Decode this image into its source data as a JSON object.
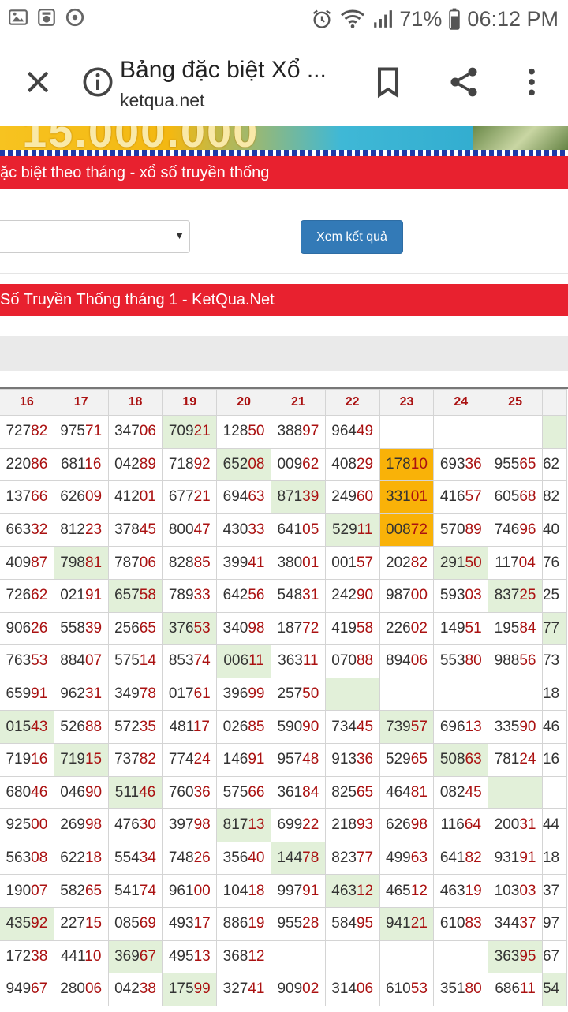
{
  "status_bar": {
    "battery": "71%",
    "time": "06:12 PM"
  },
  "toolbar": {
    "title": "Bảng đặc biệt Xổ ...",
    "url": "ketqua.net"
  },
  "banner": {
    "amount": "15.000.000"
  },
  "section1": {
    "title": "ặc biệt theo tháng - xổ số truyền thống"
  },
  "form": {
    "select_value": "",
    "submit_label": "Xem kết quả"
  },
  "section2": {
    "title": "Số Truyền Thống tháng 1 - KetQua.Net"
  },
  "table": {
    "headers": [
      "16",
      "17",
      "18",
      "19",
      "20",
      "21",
      "22",
      "23",
      "24",
      "25",
      ""
    ],
    "rows": [
      [
        {
          "v": "72782",
          "c": ""
        },
        {
          "v": "97571",
          "c": ""
        },
        {
          "v": "34706",
          "c": ""
        },
        {
          "v": "70921",
          "c": "g"
        },
        {
          "v": "12850",
          "c": ""
        },
        {
          "v": "38897",
          "c": ""
        },
        {
          "v": "96449",
          "c": ""
        },
        {
          "v": "",
          "c": ""
        },
        {
          "v": "",
          "c": ""
        },
        {
          "v": "",
          "c": ""
        },
        {
          "v": "",
          "c": "g"
        }
      ],
      [
        {
          "v": "22086",
          "c": ""
        },
        {
          "v": "68116",
          "c": ""
        },
        {
          "v": "04289",
          "c": ""
        },
        {
          "v": "71892",
          "c": ""
        },
        {
          "v": "65208",
          "c": "g"
        },
        {
          "v": "00962",
          "c": ""
        },
        {
          "v": "40829",
          "c": ""
        },
        {
          "v": "17810",
          "c": "o"
        },
        {
          "v": "69336",
          "c": ""
        },
        {
          "v": "95565",
          "c": ""
        },
        {
          "v": "62",
          "c": ""
        }
      ],
      [
        {
          "v": "13766",
          "c": ""
        },
        {
          "v": "62609",
          "c": ""
        },
        {
          "v": "41201",
          "c": ""
        },
        {
          "v": "67721",
          "c": ""
        },
        {
          "v": "69463",
          "c": ""
        },
        {
          "v": "87139",
          "c": "g"
        },
        {
          "v": "24960",
          "c": ""
        },
        {
          "v": "33101",
          "c": "o"
        },
        {
          "v": "41657",
          "c": ""
        },
        {
          "v": "60568",
          "c": ""
        },
        {
          "v": "82",
          "c": ""
        }
      ],
      [
        {
          "v": "66332",
          "c": ""
        },
        {
          "v": "81223",
          "c": ""
        },
        {
          "v": "37845",
          "c": ""
        },
        {
          "v": "80047",
          "c": ""
        },
        {
          "v": "43033",
          "c": ""
        },
        {
          "v": "64105",
          "c": ""
        },
        {
          "v": "52911",
          "c": "g"
        },
        {
          "v": "00872",
          "c": "o"
        },
        {
          "v": "57089",
          "c": ""
        },
        {
          "v": "74696",
          "c": ""
        },
        {
          "v": "40",
          "c": ""
        }
      ],
      [
        {
          "v": "40987",
          "c": ""
        },
        {
          "v": "79881",
          "c": "g"
        },
        {
          "v": "78706",
          "c": ""
        },
        {
          "v": "82885",
          "c": ""
        },
        {
          "v": "39941",
          "c": ""
        },
        {
          "v": "38001",
          "c": ""
        },
        {
          "v": "00157",
          "c": ""
        },
        {
          "v": "20282",
          "c": ""
        },
        {
          "v": "29150",
          "c": "g"
        },
        {
          "v": "11704",
          "c": ""
        },
        {
          "v": "76",
          "c": ""
        }
      ],
      [
        {
          "v": "72662",
          "c": ""
        },
        {
          "v": "02191",
          "c": ""
        },
        {
          "v": "65758",
          "c": "g"
        },
        {
          "v": "78933",
          "c": ""
        },
        {
          "v": "64256",
          "c": ""
        },
        {
          "v": "54831",
          "c": ""
        },
        {
          "v": "24290",
          "c": ""
        },
        {
          "v": "98700",
          "c": ""
        },
        {
          "v": "59303",
          "c": ""
        },
        {
          "v": "83725",
          "c": "g"
        },
        {
          "v": "25",
          "c": ""
        }
      ],
      [
        {
          "v": "90626",
          "c": ""
        },
        {
          "v": "55839",
          "c": ""
        },
        {
          "v": "25665",
          "c": ""
        },
        {
          "v": "37653",
          "c": "g"
        },
        {
          "v": "34098",
          "c": ""
        },
        {
          "v": "18772",
          "c": ""
        },
        {
          "v": "41958",
          "c": ""
        },
        {
          "v": "22602",
          "c": ""
        },
        {
          "v": "14951",
          "c": ""
        },
        {
          "v": "19584",
          "c": ""
        },
        {
          "v": "77",
          "c": "g"
        }
      ],
      [
        {
          "v": "76353",
          "c": ""
        },
        {
          "v": "88407",
          "c": ""
        },
        {
          "v": "57514",
          "c": ""
        },
        {
          "v": "85374",
          "c": ""
        },
        {
          "v": "00611",
          "c": "g"
        },
        {
          "v": "36311",
          "c": ""
        },
        {
          "v": "07088",
          "c": ""
        },
        {
          "v": "89406",
          "c": ""
        },
        {
          "v": "55380",
          "c": ""
        },
        {
          "v": "98856",
          "c": ""
        },
        {
          "v": "73",
          "c": ""
        }
      ],
      [
        {
          "v": "65991",
          "c": ""
        },
        {
          "v": "96231",
          "c": ""
        },
        {
          "v": "34978",
          "c": ""
        },
        {
          "v": "01761",
          "c": ""
        },
        {
          "v": "39699",
          "c": ""
        },
        {
          "v": "25750",
          "c": ""
        },
        {
          "v": "",
          "c": "g"
        },
        {
          "v": "",
          "c": ""
        },
        {
          "v": "",
          "c": ""
        },
        {
          "v": "",
          "c": ""
        },
        {
          "v": "18",
          "c": ""
        }
      ],
      [
        {
          "v": "01543",
          "c": "g"
        },
        {
          "v": "52688",
          "c": ""
        },
        {
          "v": "57235",
          "c": ""
        },
        {
          "v": "48117",
          "c": ""
        },
        {
          "v": "02685",
          "c": ""
        },
        {
          "v": "59090",
          "c": ""
        },
        {
          "v": "73445",
          "c": ""
        },
        {
          "v": "73957",
          "c": "g"
        },
        {
          "v": "69613",
          "c": ""
        },
        {
          "v": "33590",
          "c": ""
        },
        {
          "v": "46",
          "c": ""
        }
      ],
      [
        {
          "v": "71916",
          "c": ""
        },
        {
          "v": "71915",
          "c": "g"
        },
        {
          "v": "73782",
          "c": ""
        },
        {
          "v": "77424",
          "c": ""
        },
        {
          "v": "14691",
          "c": ""
        },
        {
          "v": "95748",
          "c": ""
        },
        {
          "v": "91336",
          "c": ""
        },
        {
          "v": "52965",
          "c": ""
        },
        {
          "v": "50863",
          "c": "g"
        },
        {
          "v": "78124",
          "c": ""
        },
        {
          "v": "16",
          "c": ""
        }
      ],
      [
        {
          "v": "68046",
          "c": ""
        },
        {
          "v": "04690",
          "c": ""
        },
        {
          "v": "51146",
          "c": "g"
        },
        {
          "v": "76036",
          "c": ""
        },
        {
          "v": "57566",
          "c": ""
        },
        {
          "v": "36184",
          "c": ""
        },
        {
          "v": "82565",
          "c": ""
        },
        {
          "v": "46481",
          "c": ""
        },
        {
          "v": "08245",
          "c": ""
        },
        {
          "v": "",
          "c": "g"
        },
        {
          "v": "",
          "c": ""
        }
      ],
      [
        {
          "v": "92500",
          "c": ""
        },
        {
          "v": "26998",
          "c": ""
        },
        {
          "v": "47630",
          "c": ""
        },
        {
          "v": "39798",
          "c": ""
        },
        {
          "v": "81713",
          "c": "g"
        },
        {
          "v": "69922",
          "c": ""
        },
        {
          "v": "21893",
          "c": ""
        },
        {
          "v": "62698",
          "c": ""
        },
        {
          "v": "11664",
          "c": ""
        },
        {
          "v": "20031",
          "c": ""
        },
        {
          "v": "44",
          "c": ""
        }
      ],
      [
        {
          "v": "56308",
          "c": ""
        },
        {
          "v": "62218",
          "c": ""
        },
        {
          "v": "55434",
          "c": ""
        },
        {
          "v": "74826",
          "c": ""
        },
        {
          "v": "35640",
          "c": ""
        },
        {
          "v": "14478",
          "c": "g"
        },
        {
          "v": "82377",
          "c": ""
        },
        {
          "v": "49963",
          "c": ""
        },
        {
          "v": "64182",
          "c": ""
        },
        {
          "v": "93191",
          "c": ""
        },
        {
          "v": "18",
          "c": ""
        }
      ],
      [
        {
          "v": "19007",
          "c": ""
        },
        {
          "v": "58265",
          "c": ""
        },
        {
          "v": "54174",
          "c": ""
        },
        {
          "v": "96100",
          "c": ""
        },
        {
          "v": "10418",
          "c": ""
        },
        {
          "v": "99791",
          "c": ""
        },
        {
          "v": "46312",
          "c": "g"
        },
        {
          "v": "46512",
          "c": ""
        },
        {
          "v": "46319",
          "c": ""
        },
        {
          "v": "10303",
          "c": ""
        },
        {
          "v": "37",
          "c": ""
        }
      ],
      [
        {
          "v": "43592",
          "c": "g"
        },
        {
          "v": "22715",
          "c": ""
        },
        {
          "v": "08569",
          "c": ""
        },
        {
          "v": "49317",
          "c": ""
        },
        {
          "v": "88619",
          "c": ""
        },
        {
          "v": "95528",
          "c": ""
        },
        {
          "v": "58495",
          "c": ""
        },
        {
          "v": "94121",
          "c": "g"
        },
        {
          "v": "61083",
          "c": ""
        },
        {
          "v": "34437",
          "c": ""
        },
        {
          "v": "97",
          "c": ""
        }
      ],
      [
        {
          "v": "17238",
          "c": ""
        },
        {
          "v": "44110",
          "c": ""
        },
        {
          "v": "36967",
          "c": "g"
        },
        {
          "v": "49513",
          "c": ""
        },
        {
          "v": "36812",
          "c": ""
        },
        {
          "v": "",
          "c": ""
        },
        {
          "v": "",
          "c": ""
        },
        {
          "v": "",
          "c": ""
        },
        {
          "v": "",
          "c": ""
        },
        {
          "v": "36395",
          "c": "g"
        },
        {
          "v": "67",
          "c": ""
        }
      ],
      [
        {
          "v": "94967",
          "c": ""
        },
        {
          "v": "28006",
          "c": ""
        },
        {
          "v": "04238",
          "c": ""
        },
        {
          "v": "17599",
          "c": "g"
        },
        {
          "v": "32741",
          "c": ""
        },
        {
          "v": "90902",
          "c": ""
        },
        {
          "v": "31406",
          "c": ""
        },
        {
          "v": "61053",
          "c": ""
        },
        {
          "v": "35180",
          "c": ""
        },
        {
          "v": "68611",
          "c": ""
        },
        {
          "v": "54",
          "c": "g"
        }
      ]
    ]
  },
  "colors": {
    "accent_red": "#e8212f",
    "button_blue": "#337ab7",
    "highlight_green": "#e2f0d9",
    "highlight_orange": "#f9b208"
  }
}
